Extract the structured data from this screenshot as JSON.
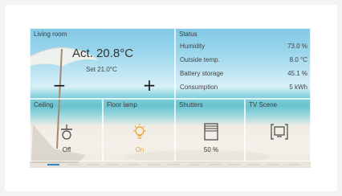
{
  "living_room": {
    "title": "Living room",
    "actual": "Act. 20.8°C",
    "set": "Set 21.0°C",
    "minus": "−",
    "plus": "+"
  },
  "status": {
    "title": "Status",
    "rows": [
      {
        "label": "Humidity",
        "value": "73.0 %"
      },
      {
        "label": "Outside temp.",
        "value": "8.0 °C"
      },
      {
        "label": "Battery storage",
        "value": "45.1 %"
      },
      {
        "label": "Consumption",
        "value": "5 kWh"
      }
    ]
  },
  "tiles": {
    "ceiling": {
      "title": "Ceiling",
      "state": "Off",
      "icon": "pendant-lamp-icon"
    },
    "floor": {
      "title": "Floor lamp",
      "state": "On",
      "icon": "bulb-icon",
      "accent": "#f0a030"
    },
    "shutters": {
      "title": "Shutters",
      "state": "50 %",
      "icon": "shutter-icon"
    },
    "tv_scene": {
      "title": "TV Scene",
      "icon": "tv-scene-icon"
    }
  },
  "pager": {
    "pages": 13,
    "active": 0,
    "active_color": "#2d86c6"
  }
}
